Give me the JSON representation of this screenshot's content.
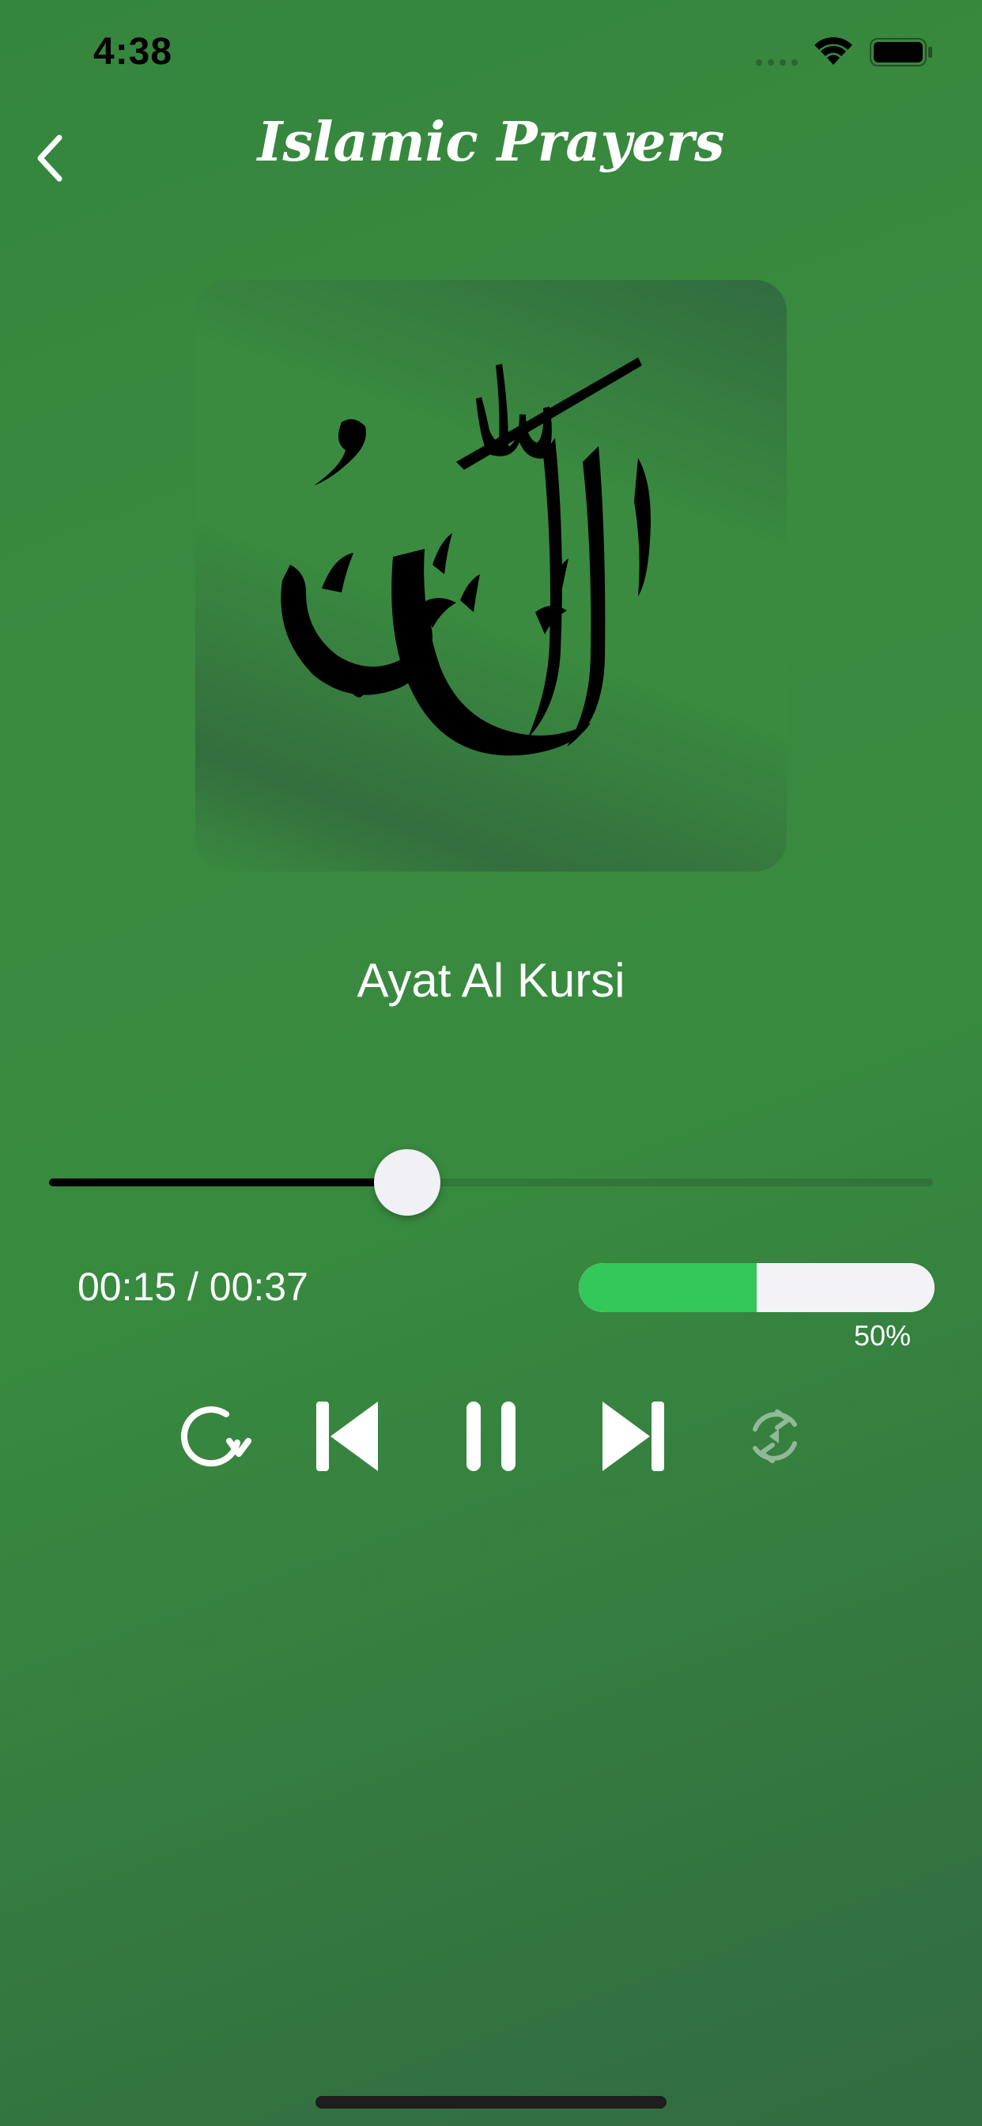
{
  "status_bar": {
    "time": "4:38",
    "icons": [
      "cellular-dots-icon",
      "wifi-icon",
      "battery-icon"
    ]
  },
  "nav": {
    "title": "Islamic Prayers",
    "back_icon": "chevron-left-icon"
  },
  "artwork": {
    "description_icon": "allah-calligraphy-icon"
  },
  "track": {
    "title": "Ayat Al Kursi"
  },
  "player": {
    "elapsed": "00:15",
    "duration": "00:37",
    "time_display": "00:15 / 00:37",
    "progress_fraction": 0.405,
    "volume_fraction": 0.5,
    "volume_label": "50%"
  },
  "controls": {
    "replay_icon": "replay-icon",
    "previous_icon": "skip-previous-icon",
    "pause_icon": "pause-icon",
    "next_icon": "skip-next-icon",
    "shuffle_icon": "shuffle-repeat-icon"
  },
  "colors": {
    "accent_volume": "#34c759",
    "background_green": "#3a8a40",
    "scrub_fill": "#000000",
    "thumb": "#f0f0f5"
  }
}
